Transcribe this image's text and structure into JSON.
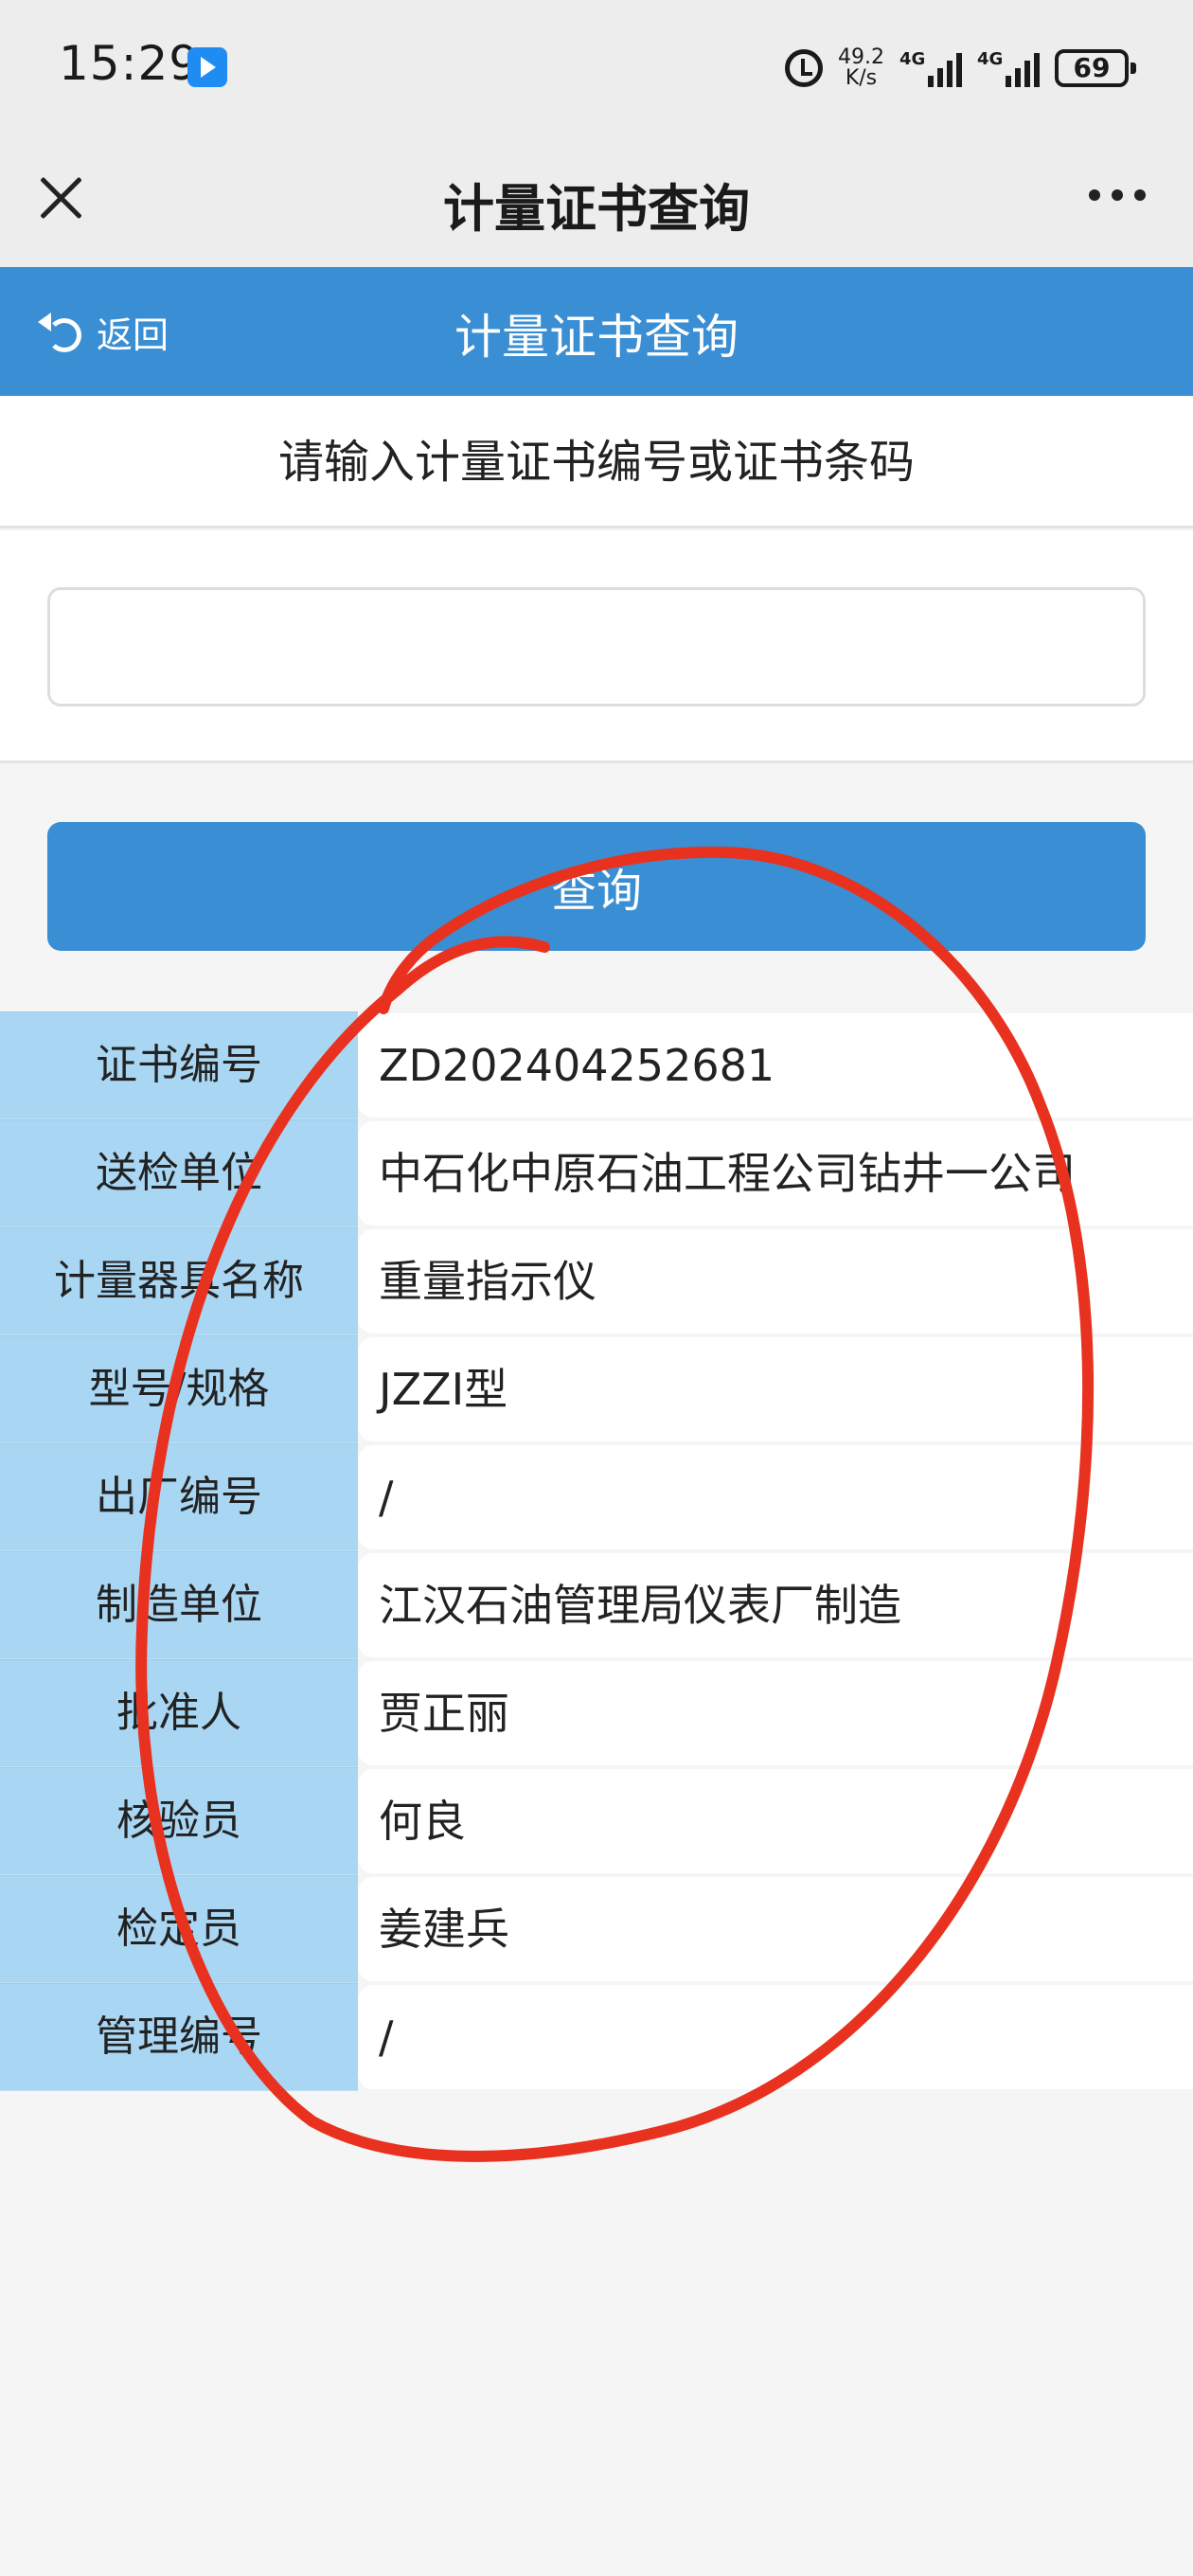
{
  "status_bar": {
    "time": "15:29",
    "network_speed_value": "49.2",
    "network_speed_unit": "K/s",
    "signal_1_type": "4G",
    "signal_2_type": "4G",
    "battery": "69"
  },
  "app_header": {
    "title": "计量证书查询"
  },
  "page_header": {
    "back_label": "返回",
    "title": "计量证书查询"
  },
  "prompt": "请输入计量证书编号或证书条码",
  "search": {
    "value": "",
    "placeholder": ""
  },
  "query_button_label": "查询",
  "results": [
    {
      "label": "证书编号",
      "value": "ZD202404252681"
    },
    {
      "label": "送检单位",
      "value": "中石化中原石油工程公司钻井一公司"
    },
    {
      "label": "计量器具名称",
      "value": "重量指示仪"
    },
    {
      "label": "型号/规格",
      "value": "JZZI型"
    },
    {
      "label": "出厂编号",
      "value": "/"
    },
    {
      "label": "制造单位",
      "value": "江汉石油管理局仪表厂制造"
    },
    {
      "label": "批准人",
      "value": "贾正丽"
    },
    {
      "label": "核验员",
      "value": "何良"
    },
    {
      "label": "检定员",
      "value": "姜建兵"
    },
    {
      "label": "管理编号",
      "value": "/"
    }
  ],
  "colors": {
    "primary_blue": "#3a8ed3",
    "label_cell_blue": "#a9d6f3",
    "annotation_red": "#e8321f"
  }
}
